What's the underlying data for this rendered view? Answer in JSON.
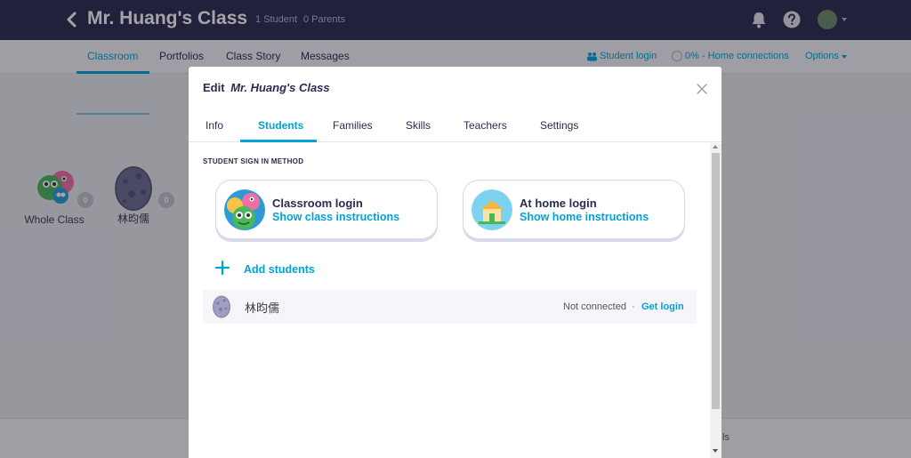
{
  "app": {
    "class_title": "Mr. Huang's Class",
    "student_count": "1 Student",
    "parent_count": "0 Parents"
  },
  "nav": {
    "tabs": [
      {
        "label": "Classroom",
        "active": true
      },
      {
        "label": "Portfolios"
      },
      {
        "label": "Class Story"
      },
      {
        "label": "Messages"
      }
    ],
    "student_login": "Student login",
    "home_connections": "0% - Home connections",
    "options": "Options"
  },
  "cards": {
    "whole_class": "Whole Class",
    "whole_points": "0",
    "student_name": "林昀儒",
    "student_points": "0"
  },
  "bottom_fragment": "ls",
  "modal": {
    "edit_label": "Edit",
    "class_name": "Mr. Huang's Class",
    "tabs": [
      {
        "label": "Info"
      },
      {
        "label": "Students",
        "active": true
      },
      {
        "label": "Families"
      },
      {
        "label": "Skills"
      },
      {
        "label": "Teachers"
      },
      {
        "label": "Settings"
      }
    ],
    "section_label": "STUDENT SIGN IN METHOD",
    "classroom_login": {
      "title": "Classroom login",
      "link": "Show class instructions"
    },
    "home_login": {
      "title": "At home login",
      "link": "Show home instructions"
    },
    "add_students": "Add students",
    "students": [
      {
        "name": "林昀儒",
        "status": "Not connected",
        "separator": "·",
        "action": "Get login"
      }
    ]
  },
  "colors": {
    "topbar": "#2c2a50",
    "accent": "#00a3d9",
    "text": "#2c2a50"
  }
}
